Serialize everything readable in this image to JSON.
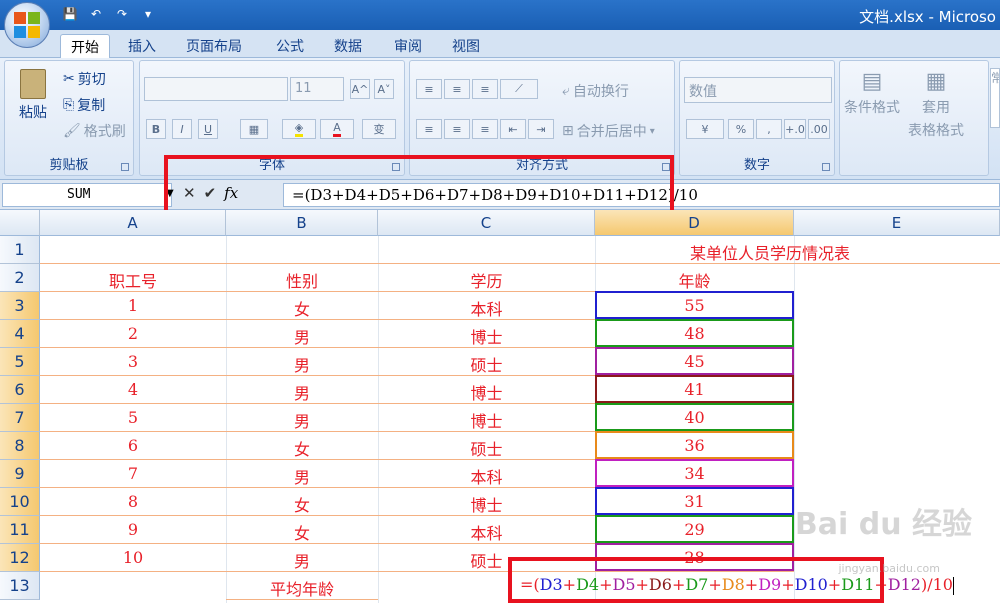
{
  "window": {
    "title": "文档.xlsx - Microso"
  },
  "qat": {
    "save": "💾",
    "undo": "↶",
    "redo": "↷",
    "more": "▾"
  },
  "tabs": [
    "开始",
    "插入",
    "页面布局",
    "公式",
    "数据",
    "审阅",
    "视图"
  ],
  "ribbon": {
    "clipboard": {
      "label": "剪贴板",
      "paste": "粘贴",
      "cut": "剪切",
      "copy": "复制",
      "format_painter": "格式刷"
    },
    "font": {
      "label": "字体",
      "size": "11",
      "bold": "B",
      "italic": "I",
      "underline": "U",
      "grow": "A^",
      "shrink": "A˅",
      "phonetic": "变"
    },
    "alignment": {
      "label": "对齐方式",
      "wrap": "自动换行",
      "merge": "合并后居中"
    },
    "number": {
      "label": "数字",
      "format": "数值",
      "percent": "%",
      "comma": ",",
      "inc_decimal": "+.0",
      "dec_decimal": ".00"
    },
    "styles": {
      "conditional": "条件格式",
      "table_format_1": "套用",
      "table_format_2": "表格格式"
    },
    "cell_styles": "常"
  },
  "formula_bar": {
    "name_box": "SUM",
    "cancel": "✕",
    "enter": "✔",
    "fx": "fx",
    "formula": "=(D3+D4+D5+D6+D7+D8+D9+D10+D11+D12)/10"
  },
  "columns": [
    "A",
    "B",
    "C",
    "D",
    "E"
  ],
  "rows": [
    "1",
    "2",
    "3",
    "4",
    "5",
    "6",
    "7",
    "8",
    "9",
    "10",
    "11",
    "12",
    "13"
  ],
  "sheet": {
    "title": "某单位人员学历情况表",
    "headers": [
      "职工号",
      "性别",
      "学历",
      "年龄"
    ],
    "data": [
      [
        "1",
        "女",
        "本科",
        "55"
      ],
      [
        "2",
        "男",
        "博士",
        "48"
      ],
      [
        "3",
        "男",
        "硕士",
        "45"
      ],
      [
        "4",
        "男",
        "博士",
        "41"
      ],
      [
        "5",
        "男",
        "博士",
        "40"
      ],
      [
        "6",
        "女",
        "硕士",
        "36"
      ],
      [
        "7",
        "男",
        "本科",
        "34"
      ],
      [
        "8",
        "女",
        "博士",
        "31"
      ],
      [
        "9",
        "女",
        "本科",
        "29"
      ],
      [
        "10",
        "男",
        "硕士",
        "28"
      ]
    ],
    "avg_label": "平均年龄",
    "edit_formula": [
      {
        "t": "=(",
        "c": "#e8212a"
      },
      {
        "t": "D3",
        "c": "#2020d0"
      },
      {
        "t": "+",
        "c": "#e8212a"
      },
      {
        "t": "D4",
        "c": "#1a9a1a"
      },
      {
        "t": "+",
        "c": "#e8212a"
      },
      {
        "t": "D5",
        "c": "#a020a0"
      },
      {
        "t": "+",
        "c": "#e8212a"
      },
      {
        "t": "D6",
        "c": "#8a1a1a"
      },
      {
        "t": "+",
        "c": "#e8212a"
      },
      {
        "t": "D7",
        "c": "#1a9a1a"
      },
      {
        "t": "+",
        "c": "#e8212a"
      },
      {
        "t": "D8",
        "c": "#e88a1a"
      },
      {
        "t": "+",
        "c": "#e8212a"
      },
      {
        "t": "D9",
        "c": "#c020c0"
      },
      {
        "t": "+",
        "c": "#e8212a"
      },
      {
        "t": "D10",
        "c": "#2020d0"
      },
      {
        "t": "+",
        "c": "#e8212a"
      },
      {
        "t": "D11",
        "c": "#1a9a1a"
      },
      {
        "t": "+",
        "c": "#e8212a"
      },
      {
        "t": "D12",
        "c": "#a020a0"
      },
      {
        "t": ")/10",
        "c": "#e8212a"
      }
    ]
  },
  "colors": {
    "accent_red": "#e8121f",
    "text_red": "#e8212a",
    "ribbon_text": "#15428b",
    "header_selected": "#f5c86f"
  },
  "watermark": {
    "text": "Bai du 经验",
    "url": "jingyan.baidu.com"
  }
}
